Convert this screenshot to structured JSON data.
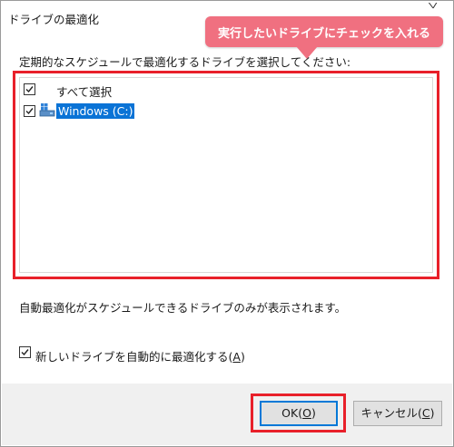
{
  "window": {
    "title": "ドライブの最適化"
  },
  "callout": {
    "text": "実行したいドライブにチェックを入れる"
  },
  "instruction": "定期的なスケジュールで最適化するドライブを選択してください:",
  "drive_list": {
    "select_all": {
      "label": "すべて選択",
      "checked": true
    },
    "drives": [
      {
        "label": "Windows (C:)",
        "checked": true,
        "selected": true,
        "icon": "drive-icon"
      }
    ]
  },
  "note": "自動最適化がスケジュールできるドライブのみが表示されます。",
  "auto_optimize": {
    "label_prefix": "新しいドライブを自動的に最適化する(",
    "accel": "A",
    "label_suffix": ")",
    "checked": true
  },
  "buttons": {
    "ok": {
      "prefix": "OK(",
      "accel": "O",
      "suffix": ")"
    },
    "cancel": {
      "prefix": "キャンセル(",
      "accel": "C",
      "suffix": ")"
    }
  },
  "colors": {
    "highlight": "#e8202a",
    "callout": "#f07080",
    "selection": "#0a73d6",
    "ok_border": "#0078d7"
  }
}
